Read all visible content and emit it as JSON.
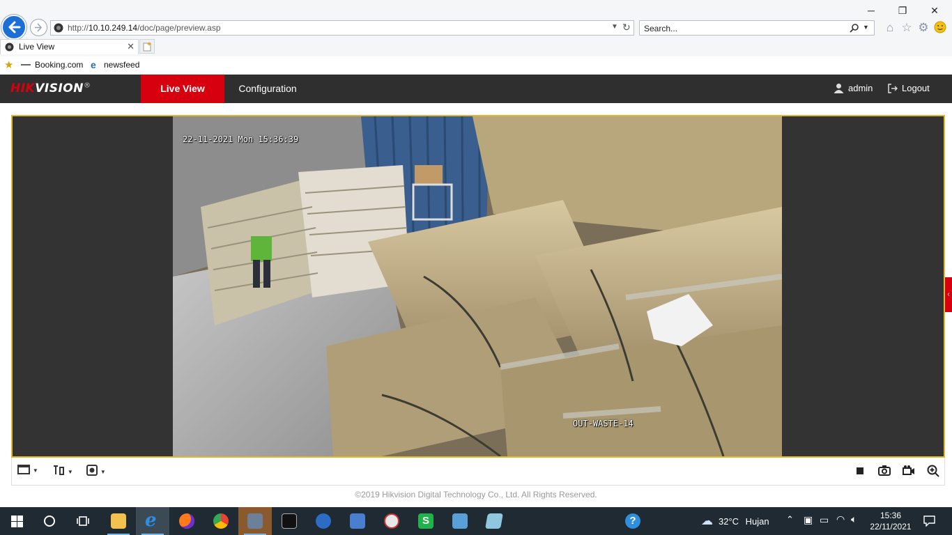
{
  "browser": {
    "url_prefix": "http://",
    "url_host": "10.10.249.14",
    "url_path": "/doc/page/preview.asp",
    "search_placeholder": "Search...",
    "tab_title": "Live View",
    "favorites": [
      {
        "label": "Booking.com"
      },
      {
        "label": "newsfeed"
      }
    ],
    "window_controls": {
      "minimize": "─",
      "restore": "❐",
      "close": "✕"
    }
  },
  "app": {
    "logo_red": "HIK",
    "logo_white": "VISION",
    "logo_mark": "®",
    "menu": {
      "live_view": "Live View",
      "configuration": "Configuration"
    },
    "user": "admin",
    "logout": "Logout"
  },
  "video": {
    "timestamp": "22-11-2021 Mon 15:36:39",
    "channel_name": "OUT-WASTE-14"
  },
  "footer": {
    "copyright": "©2019 Hikvision Digital Technology Co., Ltd. All Rights Reserved."
  },
  "taskbar": {
    "weather_temp": "32°C",
    "weather_text": "Hujan",
    "time": "15:36",
    "date": "22/11/2021"
  },
  "colors": {
    "brand_red": "#d7000f",
    "header_bg": "#2f2f2f",
    "frame_border": "#e4b72a",
    "taskbar_bg": "#1f2a33"
  }
}
